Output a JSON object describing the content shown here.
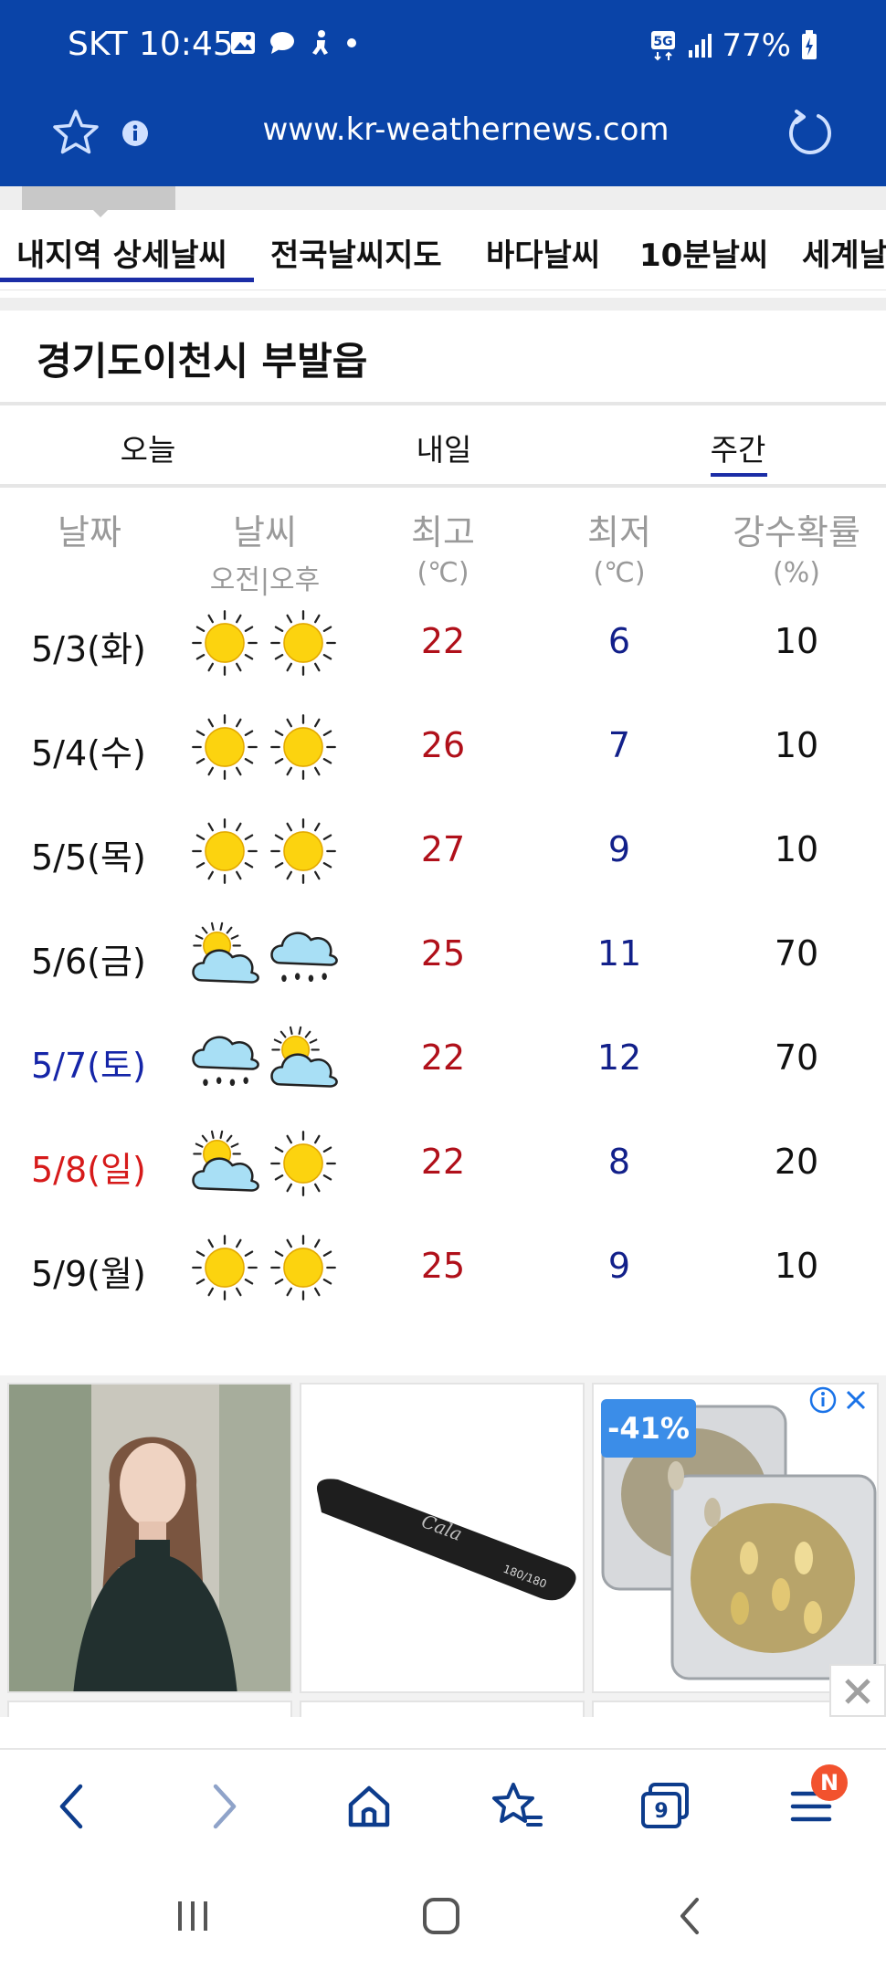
{
  "status_bar": {
    "carrier": "SKT",
    "time": "10:45",
    "network": "5G",
    "battery": "77%"
  },
  "browser": {
    "url": "www.kr-weathernews.com",
    "tab_count": "9",
    "menu_badge": "N"
  },
  "nav_tabs": [
    {
      "label": "내지역 상세날씨",
      "active": true
    },
    {
      "label": "전국날씨지도"
    },
    {
      "label": "바다날씨"
    },
    {
      "label": "10분날씨"
    },
    {
      "label": "세계날"
    }
  ],
  "location": "경기도이천시 부발읍",
  "period_tabs": [
    {
      "label": "오늘"
    },
    {
      "label": "내일"
    },
    {
      "label": "주간",
      "active": true
    }
  ],
  "table": {
    "headers": {
      "date": "날짜",
      "weather": "날씨",
      "weather_sub": "오전|오후",
      "high": "최고",
      "high_unit": "(℃)",
      "low": "최저",
      "low_unit": "(℃)",
      "pop": "강수확률",
      "pop_unit": "(%)"
    },
    "rows": [
      {
        "date": "5/3(화)",
        "am": "sunny",
        "pm": "sunny",
        "high": "22",
        "low": "6",
        "pop": "10",
        "date_color": "#111111"
      },
      {
        "date": "5/4(수)",
        "am": "sunny",
        "pm": "sunny",
        "high": "26",
        "low": "7",
        "pop": "10",
        "date_color": "#111111"
      },
      {
        "date": "5/5(목)",
        "am": "sunny",
        "pm": "sunny",
        "high": "27",
        "low": "9",
        "pop": "10",
        "date_color": "#111111"
      },
      {
        "date": "5/6(금)",
        "am": "partly-cloudy",
        "pm": "rain",
        "high": "25",
        "low": "11",
        "pop": "70",
        "date_color": "#111111"
      },
      {
        "date": "5/7(토)",
        "am": "rain",
        "pm": "partly-cloudy",
        "high": "22",
        "low": "12",
        "pop": "70",
        "date_color": "#1525a8"
      },
      {
        "date": "5/8(일)",
        "am": "partly-cloudy",
        "pm": "sunny",
        "high": "22",
        "low": "8",
        "pop": "20",
        "date_color": "#d61a1a"
      },
      {
        "date": "5/9(월)",
        "am": "sunny",
        "pm": "sunny",
        "high": "25",
        "low": "9",
        "pop": "10",
        "date_color": "#111111"
      }
    ]
  },
  "ads": {
    "discount": "-41%",
    "file_text": "180/180"
  },
  "colors": {
    "brand_blue": "#0a44a8",
    "high_temp": "#b0101a",
    "low_temp": "#12208a"
  }
}
